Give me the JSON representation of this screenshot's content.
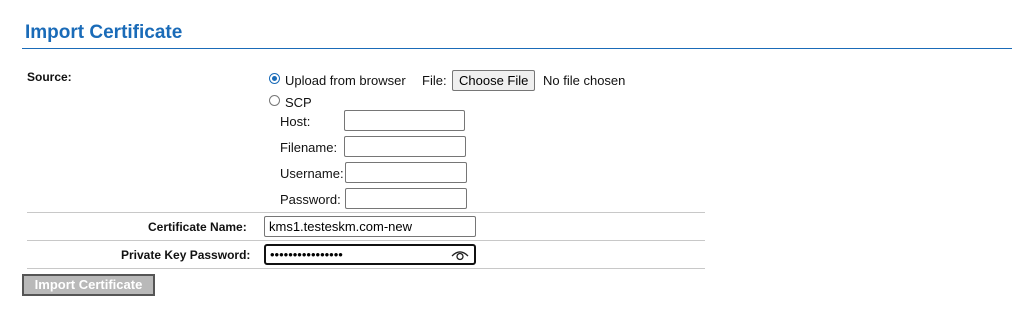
{
  "page": {
    "title": "Import Certificate"
  },
  "form": {
    "source_label": "Source:",
    "upload_option": {
      "label": "Upload from browser",
      "selected": true
    },
    "file_label": "File:",
    "choose_file_label": "Choose File",
    "no_file_text": "No file chosen",
    "scp_option": {
      "label": "SCP",
      "selected": false
    },
    "scp_fields": {
      "host_label": "Host:",
      "host_value": "",
      "filename_label": "Filename:",
      "filename_value": "",
      "username_label": "Username:",
      "username_value": "",
      "password_label": "Password:",
      "password_value": ""
    },
    "cert_name_label": "Certificate Name:",
    "cert_name_value": "kms1.testeskm.com-new",
    "private_key_label": "Private Key Password:",
    "private_key_value": "••••••••••••••••",
    "submit_label": "Import Certificate"
  },
  "colors": {
    "title": "#1a6bb8",
    "submit_bg": "#b9b9b9",
    "submit_text": "#ffffff"
  },
  "icons": {
    "reveal_password": "eye-icon"
  }
}
